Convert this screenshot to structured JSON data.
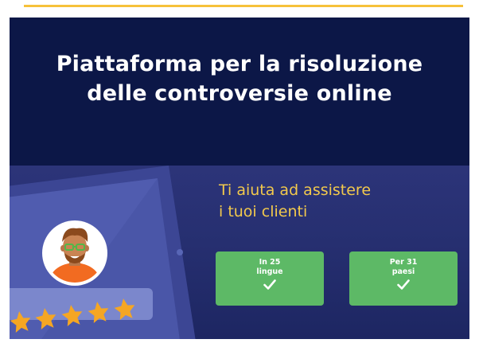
{
  "banner": {
    "title_lines": [
      "Piattaforma per la risoluzione",
      "delle controversie online"
    ],
    "tagline_lines": [
      "Ti aiuta ad assistere",
      "i tuoi clienti"
    ]
  },
  "badges": [
    {
      "line1": "In 25",
      "line2": "lingue",
      "icon": "checkmark-icon"
    },
    {
      "line1": "Per 31",
      "line2": "paesi",
      "icon": "checkmark-icon"
    }
  ],
  "rating": {
    "stars": 5,
    "max": 5
  },
  "colors": {
    "accent_yellow": "#f2c94c",
    "banner_navy": "#0c1747",
    "badge_green": "#5db966",
    "star_orange": "#f5a623",
    "avatar_orange": "#f26b21"
  }
}
